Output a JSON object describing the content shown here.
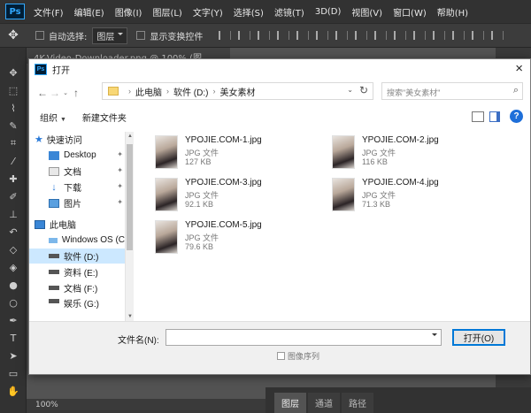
{
  "app": {
    "logo": "Ps",
    "menu": [
      "文件(F)",
      "编辑(E)",
      "图像(I)",
      "图层(L)",
      "文字(Y)",
      "选择(S)",
      "滤镜(T)",
      "3D(D)",
      "视图(V)",
      "窗口(W)",
      "帮助(H)"
    ],
    "options": {
      "auto_select_label": "自动选择:",
      "auto_select_value": "图层",
      "show_transform_label": "显示变换控件"
    },
    "doc_tab": "4K-Video-Downloader.png @ 100% (图...",
    "zoom": "100%",
    "panel_tabs": [
      "图层",
      "通道",
      "路径"
    ]
  },
  "dialog": {
    "title": "打开",
    "close": "×",
    "breadcrumb": [
      "此电脑",
      "软件 (D:)",
      "美女素材"
    ],
    "search_placeholder": "搜索\"美女素材\"",
    "commands": {
      "organize": "组织",
      "new_folder": "新建文件夹",
      "help": "?"
    },
    "nav": {
      "quick_access": "快速访问",
      "quick_items": [
        "Desktop",
        "文档",
        "下载",
        "图片"
      ],
      "this_pc": "此电脑",
      "drives": [
        "Windows OS (C",
        "软件 (D:)",
        "资料 (E:)",
        "文档 (F:)",
        "娱乐 (G:)"
      ]
    },
    "files": [
      {
        "name": "YPOJIE.COM-1.jpg",
        "type": "JPG 文件",
        "size": "127 KB"
      },
      {
        "name": "YPOJIE.COM-2.jpg",
        "type": "JPG 文件",
        "size": "116 KB"
      },
      {
        "name": "YPOJIE.COM-3.jpg",
        "type": "JPG 文件",
        "size": "92.1 KB"
      },
      {
        "name": "YPOJIE.COM-4.jpg",
        "type": "JPG 文件",
        "size": "71.3 KB"
      },
      {
        "name": "YPOJIE.COM-5.jpg",
        "type": "JPG 文件",
        "size": "79.6 KB"
      }
    ],
    "filename_label": "文件名(N):",
    "filename_value": "",
    "open_button": "打开(O)",
    "image_sequence": "图像序列"
  }
}
